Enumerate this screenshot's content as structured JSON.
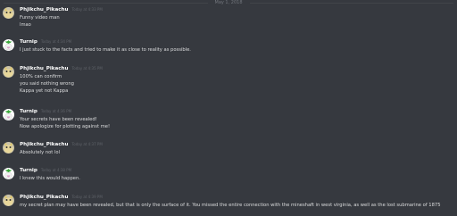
{
  "date_separator": "May 1, 2018",
  "messages": [
    {
      "author": "Phjikchu_Pikachu",
      "timestamp": "Today at 4:33 PM",
      "avatar": "pikachu-avatar-icon",
      "lines": [
        "Funny video man",
        "lmao"
      ]
    },
    {
      "author": "Turnip",
      "timestamp": "Today at 4:34 PM",
      "avatar": "turnip-avatar-icon",
      "lines": [
        "I just stuck to the facts and tried to make it as close to reality as possible."
      ]
    },
    {
      "author": "Phjikchu_Pikachu",
      "timestamp": "Today at 4:35 PM",
      "avatar": "pikachu-avatar-icon",
      "lines": [
        "100% can confirm",
        "you said nothing wrong",
        "Kappa yet not Kappa"
      ]
    },
    {
      "author": "Turnip",
      "timestamp": "Today at 4:36 PM",
      "avatar": "turnip-avatar-icon",
      "lines": [
        "Your secrets have been revealed!",
        "Now apologize for plotting against me!"
      ]
    },
    {
      "author": "Phjikchu_Pikachu",
      "timestamp": "Today at 4:37 PM",
      "avatar": "pikachu-avatar-icon",
      "lines": [
        "Absolutely not lol"
      ]
    },
    {
      "author": "Turnip",
      "timestamp": "Today at 4:38 PM",
      "avatar": "turnip-avatar-icon",
      "lines": [
        "I knew this would happen."
      ]
    },
    {
      "author": "Phjikchu_Pikachu",
      "timestamp": "Today at 4:39 PM",
      "avatar": "pikachu-avatar-icon",
      "lines": [
        "my secret plan may have been revealed, but that is only the surface of it. You missed the entire connection with the mineshaft in west virginia, as well as the lost submarine of 1875"
      ]
    }
  ]
}
